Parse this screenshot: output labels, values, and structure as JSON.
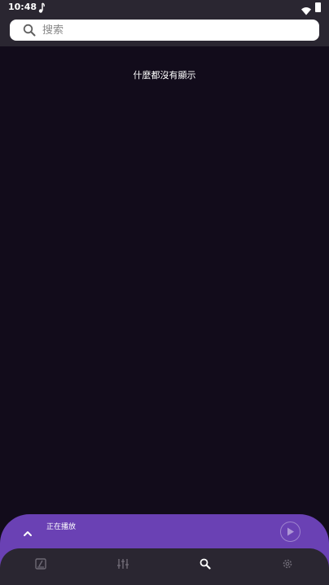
{
  "status_bar": {
    "time": "10:48",
    "icons": [
      "music-note-icon",
      "wifi-icon",
      "battery-icon"
    ]
  },
  "search": {
    "placeholder": "搜索",
    "value": "",
    "icon": "search-icon"
  },
  "main": {
    "empty_message": "什麼都沒有顯示"
  },
  "now_playing": {
    "label": "正在播放",
    "expand_icon": "chevron-up-icon",
    "play_icon": "play-icon"
  },
  "bottom_nav": {
    "items": [
      {
        "name": "library",
        "icon": "music-library-icon",
        "active": false
      },
      {
        "name": "equalizer",
        "icon": "equalizer-icon",
        "active": false
      },
      {
        "name": "search",
        "icon": "search-icon",
        "active": true
      },
      {
        "name": "settings",
        "icon": "gear-icon",
        "active": false
      }
    ]
  },
  "colors": {
    "background": "#120c1b",
    "bar": "#2a2631",
    "accent": "#6a41b4",
    "inactive_icon": "#6e6a75",
    "active_icon": "#ffffff"
  }
}
